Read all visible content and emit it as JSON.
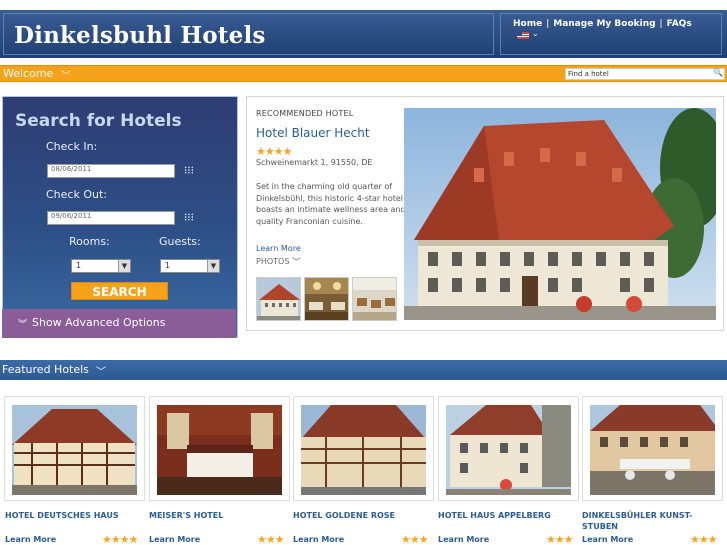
{
  "header": {
    "title": "Dinkelsbuhl Hotels",
    "nav": [
      "Home",
      "Manage My Booking",
      "FAQs"
    ],
    "separator": "|"
  },
  "welcome": {
    "label": "Welcome",
    "search_placeholder": "Find a hotel"
  },
  "search": {
    "title": "Search for Hotels",
    "check_in_label": "Check In:",
    "check_in_value": "08/06/2011",
    "check_out_label": "Check Out:",
    "check_out_value": "09/06/2011",
    "rooms_label": "Rooms:",
    "rooms_value": "1",
    "guests_label": "Guests:",
    "guests_value": "1",
    "button": "SEARCH",
    "advanced": "Show Advanced Options"
  },
  "recommended": {
    "kicker": "RECOMMENDED HOTEL",
    "name": "Hotel Blauer Hecht",
    "stars": "★★★★",
    "address": "Schweinemarkt 1, 91550, DE",
    "description": "Set in the charming old quarter of Dinkelsbühl, this historic 4-star hotel boasts an intimate wellness area and quality Franconian cuisine.",
    "learn_more": "Learn More",
    "photos": "PHOTOS"
  },
  "featured": {
    "label": "Featured Hotels",
    "hotels": [
      {
        "name": "HOTEL DEUTSCHES HAUS",
        "learn_more": "Learn More",
        "stars": "★★★★"
      },
      {
        "name": "MEISER'S HOTEL",
        "learn_more": "Learn More",
        "stars": "★★★"
      },
      {
        "name": "HOTEL GOLDENE ROSE",
        "learn_more": "Learn More",
        "stars": "★★★"
      },
      {
        "name": "HOTEL HAUS APPELBERG",
        "learn_more": "Learn More",
        "stars": "★★★"
      },
      {
        "name": "DINKELSBÜHLER KUNST-STUBEN",
        "learn_more": "Learn More",
        "stars": "★★★"
      }
    ]
  },
  "colors": {
    "header_blue": "#2b4c80",
    "accent_orange": "#f7a21b",
    "link_blue": "#2b5d94",
    "star_gold": "#f5a623",
    "advanced_purple": "#8a5c98"
  }
}
